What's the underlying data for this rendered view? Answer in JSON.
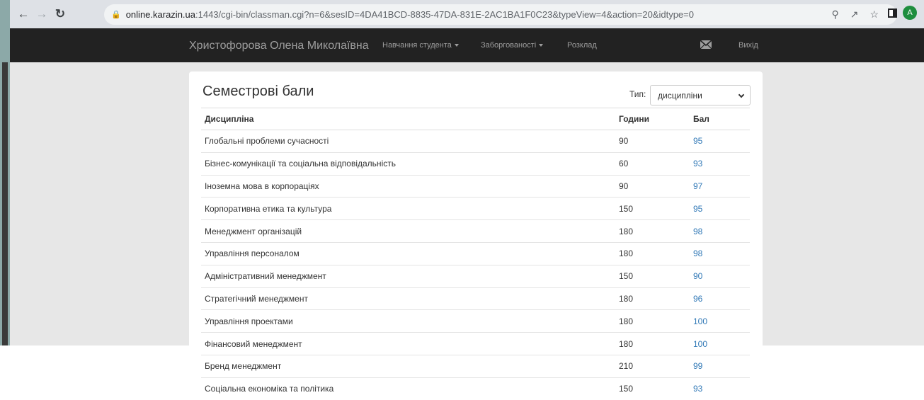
{
  "browser": {
    "url_host": "online.karazin.ua",
    "url_path": ":1443/cgi-bin/classman.cgi?n=6&sesID=4DA41BCD-8835-47DA-831E-2AC1BA1F0C23&typeView=4&action=20&idtype=0",
    "profile_initial": "A"
  },
  "navbar": {
    "brand": "Христофорова Олена Миколаївна",
    "items": [
      {
        "label": "Навчання студента"
      },
      {
        "label": "Заборгованості"
      },
      {
        "label": "Розклад"
      }
    ],
    "logout": "Вихід"
  },
  "panel": {
    "title": "Семестрові бали",
    "type_label": "Тип:",
    "type_value": "дисципліни",
    "columns": [
      "Дисципліна",
      "Години",
      "Бал"
    ],
    "rows": [
      {
        "name": "Глобальні проблеми сучасності",
        "hours": "90",
        "score": "95"
      },
      {
        "name": "Бізнес-комунікації та соціальна відповідальність",
        "hours": "60",
        "score": "93"
      },
      {
        "name": "Іноземна мова в корпораціях",
        "hours": "90",
        "score": "97"
      },
      {
        "name": "Корпоративна етика та культура",
        "hours": "150",
        "score": "95"
      },
      {
        "name": "Менеджмент організацій",
        "hours": "180",
        "score": "98"
      },
      {
        "name": "Управління персоналом",
        "hours": "180",
        "score": "98"
      },
      {
        "name": "Адміністративний менеджмент",
        "hours": "150",
        "score": "90"
      },
      {
        "name": "Стратегічний менеджмент",
        "hours": "180",
        "score": "96"
      },
      {
        "name": "Управління проектами",
        "hours": "180",
        "score": "100"
      },
      {
        "name": "Фінансовий менеджмент",
        "hours": "180",
        "score": "100"
      },
      {
        "name": "Бренд менеджмент",
        "hours": "210",
        "score": "99"
      },
      {
        "name": "Соціальна економіка та політика",
        "hours": "150",
        "score": "93"
      }
    ]
  },
  "colors": {
    "navbar_bg": "#222222",
    "nav_text": "#9d9d9d",
    "link": "#337ab7",
    "content_bg": "#e7e7e7"
  }
}
